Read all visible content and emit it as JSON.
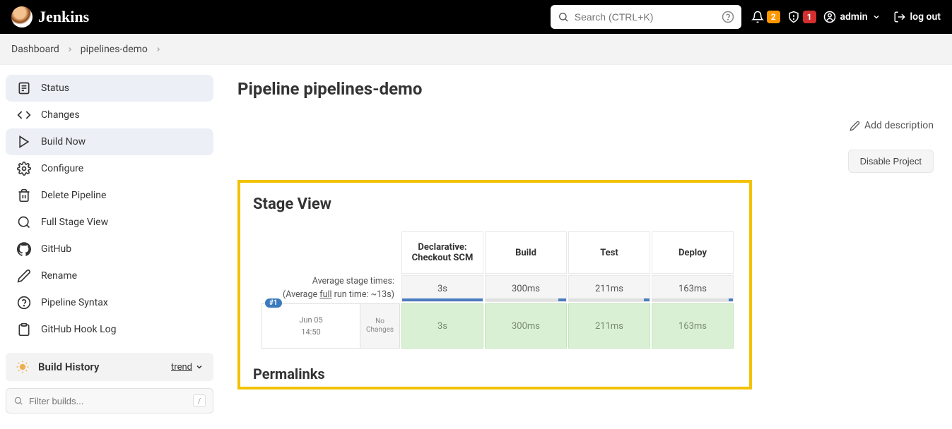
{
  "header": {
    "brand": "Jenkins",
    "search_placeholder": "Search (CTRL+K)",
    "notif_count": "2",
    "alert_count": "1",
    "user": "admin",
    "logout": "log out"
  },
  "breadcrumb": {
    "items": [
      "Dashboard",
      "pipelines-demo"
    ]
  },
  "sidebar": {
    "items": [
      {
        "label": "Status"
      },
      {
        "label": "Changes"
      },
      {
        "label": "Build Now"
      },
      {
        "label": "Configure"
      },
      {
        "label": "Delete Pipeline"
      },
      {
        "label": "Full Stage View"
      },
      {
        "label": "GitHub"
      },
      {
        "label": "Rename"
      },
      {
        "label": "Pipeline Syntax"
      },
      {
        "label": "GitHub Hook Log"
      }
    ],
    "build_history": "Build History",
    "trend": "trend",
    "filter_placeholder": "Filter builds...",
    "filter_key": "/"
  },
  "page": {
    "title": "Pipeline pipelines-demo",
    "add_description": "Add description",
    "disable": "Disable Project",
    "stage_view": "Stage View",
    "permalinks": "Permalinks",
    "avg_label1": "Average stage times:",
    "avg_label2_pre": "(Average ",
    "avg_label2_u": "full",
    "avg_label2_post": " run time: ~13s)"
  },
  "stages": {
    "headers": [
      "Declarative: Checkout SCM",
      "Build",
      "Test",
      "Deploy"
    ],
    "avg": [
      "3s",
      "300ms",
      "211ms",
      "163ms"
    ],
    "avg_fill_pct": [
      100,
      10,
      7,
      5
    ],
    "runs": [
      {
        "badge": "#1",
        "date": "Jun 05",
        "time": "14:50",
        "changes1": "No",
        "changes2": "Changes",
        "cells": [
          "3s",
          "300ms",
          "211ms",
          "163ms"
        ]
      }
    ]
  }
}
